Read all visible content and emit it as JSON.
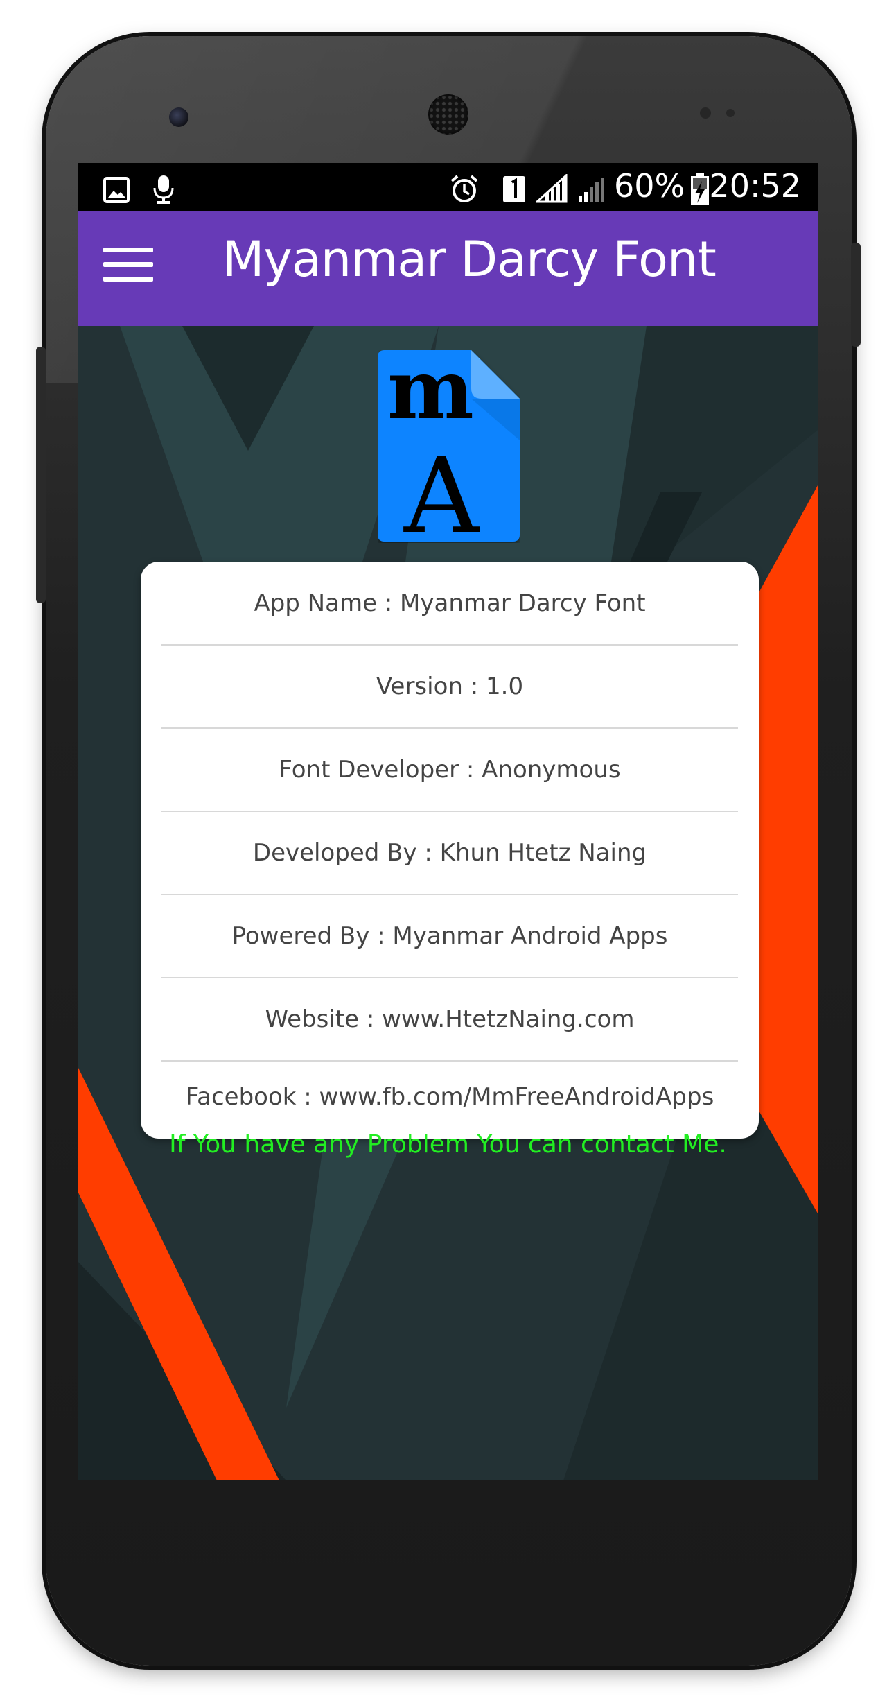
{
  "status_bar": {
    "left_icons": [
      "image-icon",
      "voice-mic-icon"
    ],
    "right_icons": [
      "alarm-clock-icon",
      "sim-1-icon",
      "signal-full-icon",
      "signal-weak-icon",
      "battery-charging-icon"
    ],
    "battery_percent": "60%",
    "time": "20:52"
  },
  "app_bar": {
    "title": "Myanmar Darcy Font",
    "menu_icon": "hamburger-menu-icon",
    "color": "#673ab7"
  },
  "logo": {
    "glyph_top": "m",
    "glyph_bottom": "A",
    "color": "#0a84ff"
  },
  "info": {
    "rows": [
      "App Name : Myanmar Darcy Font",
      "Version : 1.0",
      "Font Developer : Anonymous",
      "Developed By : Khun Htetz Naing",
      "Powered By : Myanmar Android Apps",
      "Website : www.HtetzNaing.com",
      "Facebook : www.fb.com/MmFreeAndroidApps"
    ]
  },
  "contact_message": "If You have any Problem You can contact Me.",
  "colors": {
    "background": "#1d2a2c",
    "accent_stripe": "#ff3d00",
    "contact_text": "#22ee22"
  }
}
